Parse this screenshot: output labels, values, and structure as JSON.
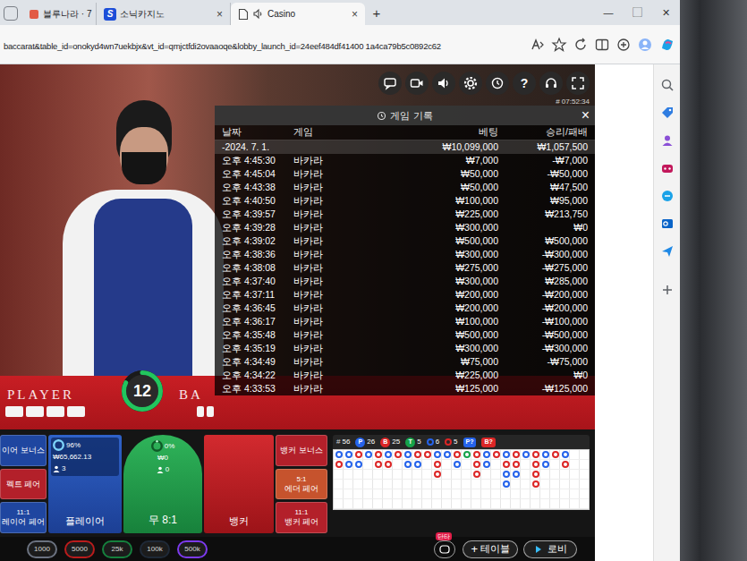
{
  "browser": {
    "tabs": [
      {
        "label": "블루나라 · 7",
        "kind": "page",
        "selected": false,
        "close": "×"
      },
      {
        "label": "소닉카지노",
        "kind": "logo",
        "icon_text": "S",
        "selected": false,
        "close": "×"
      },
      {
        "label": "Casino",
        "kind": "audio",
        "selected": true,
        "close": "×"
      }
    ],
    "new_tab": "+",
    "window_controls": [
      "—",
      "▢",
      "✕"
    ],
    "address": "baccarat&table_id=onokyd4wn7uekbjx&vt_id=qmjctfdi2ovaaoqe&lobby_launch_id=24eef484df41400 1a4ca79b5c0892c62",
    "sidebar": [
      {
        "kind": "search",
        "color": "#5f6368"
      },
      {
        "kind": "tag",
        "color": "#2f7de1"
      },
      {
        "kind": "person",
        "color": "#8a4fd6"
      },
      {
        "kind": "puzzle",
        "color": "#c2185b"
      },
      {
        "kind": "copilot",
        "color": "#1aa2e8"
      },
      {
        "kind": "outlook",
        "color": "#0a64c8"
      },
      {
        "kind": "send",
        "color": "#1e88e5"
      },
      {
        "kind": "plus",
        "color": "#5f6368"
      }
    ]
  },
  "game": {
    "help_glyph": "?",
    "clock": "# 07:52:34",
    "history": {
      "title": "게임 기록",
      "close": "×",
      "columns": [
        "날짜",
        "게임",
        "베팅",
        "승리/패배"
      ],
      "summary": {
        "date": "-2024. 7. 1.",
        "bet": "₩10,099,000",
        "result": "₩1,057,500"
      },
      "rows": [
        [
          "오후 4:45:30",
          "바카라",
          "₩7,000",
          "-₩7,000"
        ],
        [
          "오후 4:45:04",
          "바카라",
          "₩50,000",
          "-₩50,000"
        ],
        [
          "오후 4:43:38",
          "바카라",
          "₩50,000",
          "₩47,500"
        ],
        [
          "오후 4:40:50",
          "바카라",
          "₩100,000",
          "₩95,000"
        ],
        [
          "오후 4:39:57",
          "바카라",
          "₩225,000",
          "₩213,750"
        ],
        [
          "오후 4:39:28",
          "바카라",
          "₩300,000",
          "₩0"
        ],
        [
          "오후 4:39:02",
          "바카라",
          "₩500,000",
          "₩500,000"
        ],
        [
          "오후 4:38:36",
          "바카라",
          "₩300,000",
          "-₩300,000"
        ],
        [
          "오후 4:38:08",
          "바카라",
          "₩275,000",
          "-₩275,000"
        ],
        [
          "오후 4:37:40",
          "바카라",
          "₩300,000",
          "₩285,000"
        ],
        [
          "오후 4:37:11",
          "바카라",
          "₩200,000",
          "-₩200,000"
        ],
        [
          "오후 4:36:45",
          "바카라",
          "₩200,000",
          "-₩200,000"
        ],
        [
          "오후 4:36:17",
          "바카라",
          "₩100,000",
          "-₩100,000"
        ],
        [
          "오후 4:35:48",
          "바카라",
          "₩500,000",
          "-₩500,000"
        ],
        [
          "오후 4:35:19",
          "바카라",
          "₩300,000",
          "-₩300,000"
        ],
        [
          "오후 4:34:49",
          "바카라",
          "₩75,000",
          "-₩75,000"
        ],
        [
          "오후 4:34:22",
          "바카라",
          "₩225,000",
          "₩0"
        ],
        [
          "오후 4:33:53",
          "바카라",
          "₩125,000",
          "-₩125,000"
        ]
      ]
    },
    "table": {
      "player_label": "PLAYER",
      "banker_label": "BA",
      "timer": "12",
      "timer_level": 0.82
    },
    "bets": {
      "left": [
        {
          "label": "이어 보너스",
          "color": "#1f46a0"
        },
        {
          "label": "펙트 페어",
          "color": "#b3202a"
        },
        {
          "odds": "11:1",
          "label": "레이어 페어",
          "color": "#1f46a0"
        }
      ],
      "player": {
        "label": "플레이어",
        "percent": "96%",
        "level": 0.96,
        "amount": "₩65,662.13",
        "players": "3"
      },
      "tie": {
        "label": "무 8:1",
        "percent": "0%",
        "level": 0,
        "amount": "₩0",
        "players": "0"
      },
      "banker": {
        "label": "뱅커"
      },
      "right": [
        {
          "label": "뱅커 보너스",
          "color": "#b3202a"
        },
        {
          "odds": "5:1",
          "label": "에더 페어",
          "color": "#c6532d"
        },
        {
          "odds": "11:1",
          "label": "뱅커 페어",
          "color": "#b3202a"
        }
      ]
    },
    "scoreboard": {
      "stats": [
        {
          "kind": "plain",
          "badge": "#",
          "value": "56"
        },
        {
          "kind": "badge",
          "badge": "P",
          "value": "26",
          "color": "#2563eb"
        },
        {
          "kind": "badge",
          "badge": "B",
          "value": "25",
          "color": "#dc2626"
        },
        {
          "kind": "badge",
          "badge": "T",
          "value": "5",
          "color": "#16a34a"
        },
        {
          "kind": "dot",
          "value": "6",
          "color": "#2563eb"
        },
        {
          "kind": "dot",
          "value": "5",
          "color": "#dc2626"
        },
        {
          "kind": "pill",
          "badge": "P?",
          "color": "#2563eb"
        },
        {
          "kind": "pill",
          "badge": "B?",
          "color": "#dc2626"
        }
      ],
      "road": [
        [
          "P",
          "B"
        ],
        [
          "P",
          "P"
        ],
        [
          "B",
          "P"
        ],
        [
          "P"
        ],
        [
          "B",
          "B"
        ],
        [
          "P",
          "B"
        ],
        [
          "B"
        ],
        [
          "P",
          "P"
        ],
        [
          "B",
          "P"
        ],
        [
          "B"
        ],
        [
          "P",
          "B",
          "B"
        ],
        [
          "P"
        ],
        [
          "B",
          "P"
        ],
        [
          "T"
        ],
        [
          "B",
          "B",
          "B"
        ],
        [
          "P",
          "P"
        ],
        [
          "B"
        ],
        [
          "P",
          "B",
          "P",
          "P"
        ],
        [
          "B",
          "B",
          "P"
        ],
        [
          "P"
        ],
        [
          "B",
          "B",
          "B",
          "B"
        ],
        [
          "P",
          "P"
        ],
        [
          "B"
        ],
        [
          "P",
          "B"
        ],
        [],
        []
      ]
    },
    "bottom": {
      "chips": [
        {
          "label": "1000",
          "color": "#6b7280"
        },
        {
          "label": "5000",
          "color": "#b91c1c"
        },
        {
          "label": "25k",
          "color": "#15803d"
        },
        {
          "label": "100k",
          "color": "#1f2937"
        },
        {
          "label": "500k",
          "color": "#7c3aed"
        }
      ],
      "badge": "단타",
      "table_plus": "+",
      "table_label": "테이블",
      "lobby_label": "로비"
    }
  }
}
